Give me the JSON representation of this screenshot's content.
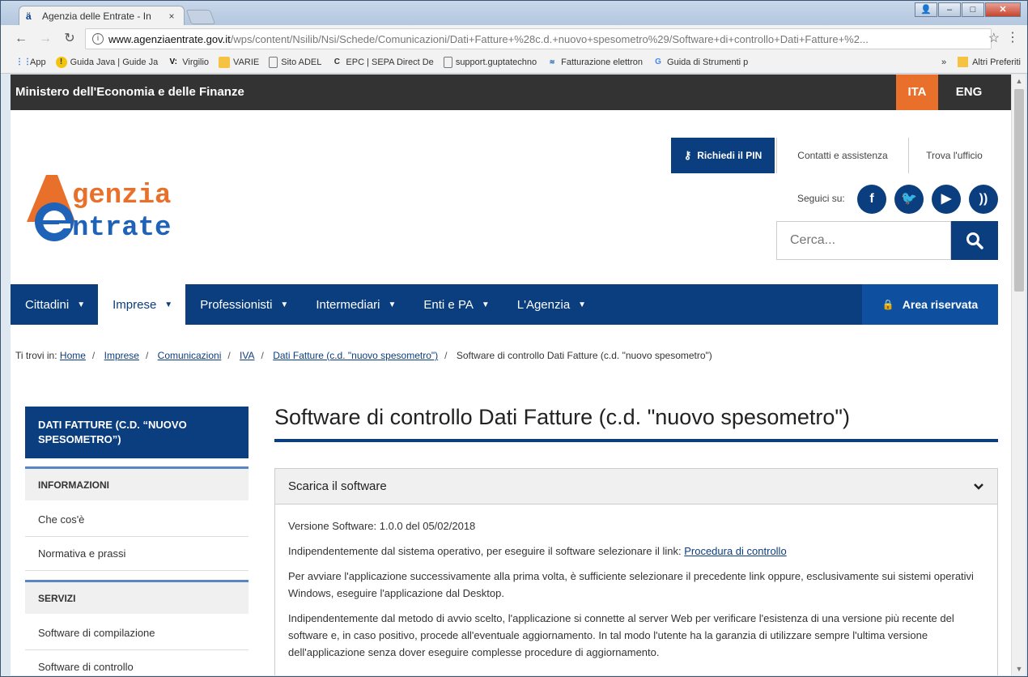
{
  "browser": {
    "tab_title": "Agenzia delle Entrate - In",
    "tab_close": "×",
    "url_host": "www.agenziaentrate.gov.it",
    "url_path": "/wps/content/Nsilib/Nsi/Schede/Comunicazioni/Dati+Fatture+%28c.d.+nuovo+spesometro%29/Software+di+controllo+Dati+Fatture+%2...",
    "bookmarks": [
      {
        "label": "App",
        "icon": "apps-icon"
      },
      {
        "label": "Guida Java | Guide Ja",
        "icon": "java-icon"
      },
      {
        "label": "Virgilio",
        "icon": "virgilio-icon"
      },
      {
        "label": "VARIE",
        "icon": "folder-icon"
      },
      {
        "label": "Sito ADEL",
        "icon": "page-icon"
      },
      {
        "label": "EPC | SEPA Direct De",
        "icon": "epc-icon"
      },
      {
        "label": "support.guptatechno",
        "icon": "page-icon"
      },
      {
        "label": "Fatturazione elettron",
        "icon": "fattura-icon"
      },
      {
        "label": "Guida di Strumenti p",
        "icon": "google-icon"
      }
    ],
    "bookmarks_more": "»",
    "bookmarks_other": "Altri Preferiti"
  },
  "site": {
    "ministry": "Ministero dell'Economia e delle Finanze",
    "lang_ita": "ITA",
    "lang_eng": "ENG",
    "pin_button": "Richiedi il PIN",
    "contacts_link": "Contatti e assistenza",
    "office_link": "Trova l'ufficio",
    "follow_label": "Seguici su:",
    "search_placeholder": "Cerca...",
    "logo_top": "genzia",
    "logo_bottom": "ntrate",
    "nav": [
      {
        "label": "Cittadini",
        "active": false
      },
      {
        "label": "Imprese",
        "active": true
      },
      {
        "label": "Professionisti",
        "active": false
      },
      {
        "label": "Intermediari",
        "active": false
      },
      {
        "label": "Enti e PA",
        "active": false
      },
      {
        "label": "L'Agenzia",
        "active": false
      }
    ],
    "reserved_area": "Area riservata"
  },
  "breadcrumb": {
    "prefix": "Ti trovi in:",
    "links": [
      "Home",
      "Imprese",
      "Comunicazioni",
      "IVA",
      "Dati Fatture (c.d. \"nuovo spesometro\")"
    ],
    "current": "Software di controllo Dati Fatture (c.d. \"nuovo spesometro\")"
  },
  "sidebar": {
    "header": "DATI FATTURE (C.D. “NUOVO SPESOMETRO”)",
    "section_info": "INFORMAZIONI",
    "items_info": [
      "Che cos'è",
      "Normativa e prassi"
    ],
    "section_services": "SERVIZI",
    "items_services": [
      "Software di compilazione",
      "Software di controllo"
    ]
  },
  "content": {
    "title": "Software di controllo Dati Fatture (c.d. \"nuovo spesometro\")",
    "accordion_title": "Scarica il software",
    "version": "Versione Software: 1.0.0 del  05/02/2018",
    "p1_text": "Indipendentemente dal sistema operativo, per eseguire il software selezionare il link: ",
    "p1_link": "Procedura di controllo",
    "p2": "Per avviare l'applicazione successivamente alla prima volta, è sufficiente selezionare il precedente link oppure, esclusivamente sui sistemi operativi Windows, eseguire l'applicazione dal Desktop.",
    "p3": "Indipendentemente dal metodo di avvio scelto, l'applicazione si connette al server Web per verificare l'esistenza di una versione più recente del software e, in caso positivo, procede all'eventuale aggiornamento. In tal modo l'utente ha la garanzia di utilizzare sempre l'ultima versione dell'applicazione senza dover eseguire complesse procedure di aggiornamento."
  },
  "colors": {
    "brand_blue": "#0b3e7e",
    "accent_orange": "#e8702a",
    "top_band": "#333333"
  }
}
